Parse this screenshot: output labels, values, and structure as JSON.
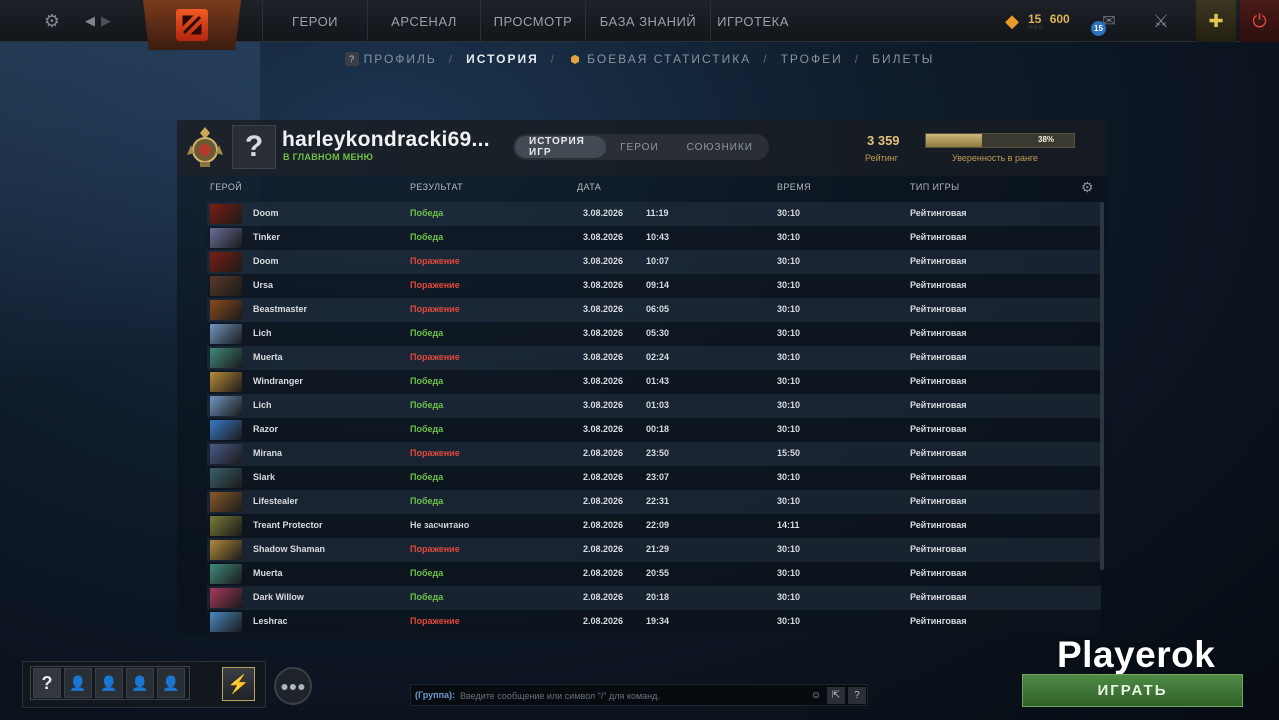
{
  "topbar": {
    "nav": [
      "ГЕРОИ",
      "АРСЕНАЛ",
      "ПРОСМОТР",
      "БАЗА ЗНАНИЙ",
      "ИГРОТЕКА"
    ],
    "currency_a": "15",
    "currency_b": "600",
    "currency_dots": "○○○",
    "notification_count": "15"
  },
  "subnav": {
    "profile": "ПРОФИЛЬ",
    "history": "ИСТОРИЯ",
    "battle_stats": "БОЕВАЯ СТАТИСТИКА",
    "trophies": "ТРОФЕИ",
    "tickets": "БИЛЕТЫ",
    "separator": "/",
    "help_glyph": "?"
  },
  "profile": {
    "avatar_glyph": "?",
    "username": "harleykondracki69...",
    "status": "В ГЛАВНОМ МЕНЮ",
    "tabs": [
      "ИСТОРИЯ ИГР",
      "ГЕРОИ",
      "СОЮЗНИКИ"
    ],
    "rating_value": "3 359",
    "rating_label": "Рейтинг",
    "confidence_value": "38%",
    "confidence_fraction": 0.38,
    "confidence_label": "Уверенность в ранге"
  },
  "columns": {
    "hero": "ГЕРОЙ",
    "result": "РЕЗУЛЬТАТ",
    "date": "ДАТА",
    "duration": "ВРЕМЯ",
    "game_type": "ТИП ИГРЫ"
  },
  "matches": [
    {
      "hero": "Doom",
      "result": "Победа",
      "date": "3.08.2026",
      "time": "11:19",
      "duration": "30:10",
      "type": "Рейтинговая"
    },
    {
      "hero": "Tinker",
      "result": "Победа",
      "date": "3.08.2026",
      "time": "10:43",
      "duration": "30:10",
      "type": "Рейтинговая"
    },
    {
      "hero": "Doom",
      "result": "Поражение",
      "date": "3.08.2026",
      "time": "10:07",
      "duration": "30:10",
      "type": "Рейтинговая"
    },
    {
      "hero": "Ursa",
      "result": "Поражение",
      "date": "3.08.2026",
      "time": "09:14",
      "duration": "30:10",
      "type": "Рейтинговая"
    },
    {
      "hero": "Beastmaster",
      "result": "Поражение",
      "date": "3.08.2026",
      "time": "06:05",
      "duration": "30:10",
      "type": "Рейтинговая"
    },
    {
      "hero": "Lich",
      "result": "Победа",
      "date": "3.08.2026",
      "time": "05:30",
      "duration": "30:10",
      "type": "Рейтинговая"
    },
    {
      "hero": "Muerta",
      "result": "Поражение",
      "date": "3.08.2026",
      "time": "02:24",
      "duration": "30:10",
      "type": "Рейтинговая"
    },
    {
      "hero": "Windranger",
      "result": "Победа",
      "date": "3.08.2026",
      "time": "01:43",
      "duration": "30:10",
      "type": "Рейтинговая"
    },
    {
      "hero": "Lich",
      "result": "Победа",
      "date": "3.08.2026",
      "time": "01:03",
      "duration": "30:10",
      "type": "Рейтинговая"
    },
    {
      "hero": "Razor",
      "result": "Победа",
      "date": "3.08.2026",
      "time": "00:18",
      "duration": "30:10",
      "type": "Рейтинговая"
    },
    {
      "hero": "Mirana",
      "result": "Поражение",
      "date": "2.08.2026",
      "time": "23:50",
      "duration": "15:50",
      "type": "Рейтинговая"
    },
    {
      "hero": "Slark",
      "result": "Победа",
      "date": "2.08.2026",
      "time": "23:07",
      "duration": "30:10",
      "type": "Рейтинговая"
    },
    {
      "hero": "Lifestealer",
      "result": "Победа",
      "date": "2.08.2026",
      "time": "22:31",
      "duration": "30:10",
      "type": "Рейтинговая"
    },
    {
      "hero": "Treant Protector",
      "result": "Не засчитано",
      "date": "2.08.2026",
      "time": "22:09",
      "duration": "14:11",
      "type": "Рейтинговая"
    },
    {
      "hero": "Shadow Shaman",
      "result": "Поражение",
      "date": "2.08.2026",
      "time": "21:29",
      "duration": "30:10",
      "type": "Рейтинговая"
    },
    {
      "hero": "Muerta",
      "result": "Победа",
      "date": "2.08.2026",
      "time": "20:55",
      "duration": "30:10",
      "type": "Рейтинговая"
    },
    {
      "hero": "Dark Willow",
      "result": "Победа",
      "date": "2.08.2026",
      "time": "20:18",
      "duration": "30:10",
      "type": "Рейтинговая"
    },
    {
      "hero": "Leshrac",
      "result": "Поражение",
      "date": "2.08.2026",
      "time": "19:34",
      "duration": "30:10",
      "type": "Рейтинговая"
    }
  ],
  "hero_colors": {
    "Doom": "#7a1f12",
    "Tinker": "#6a6f9a",
    "Ursa": "#5a3a2a",
    "Beastmaster": "#8a4a1e",
    "Lich": "#6f95c0",
    "Muerta": "#3f8a7a",
    "Windranger": "#b98a3a",
    "Razor": "#3a7ac8",
    "Mirana": "#4a5a8a",
    "Slark": "#3a5f6a",
    "Lifestealer": "#8a5a2a",
    "Treant Protector": "#7a7a3a",
    "Shadow Shaman": "#b08a3a",
    "Dark Willow": "#a83a5a",
    "Leshrac": "#4a8ac0"
  },
  "result_colors": {
    "Победа": "#6cc04a",
    "Поражение": "#e04a3a",
    "Не засчитано": "#cfd2d6"
  },
  "bottom": {
    "party_unknown_glyph": "?",
    "chat_label": "(Группа):",
    "chat_placeholder": "Введите сообщение или символ \"/\" для команд.",
    "chat_help": "?",
    "play_label": "ИГРАТЬ",
    "watermark": "Playerok"
  }
}
